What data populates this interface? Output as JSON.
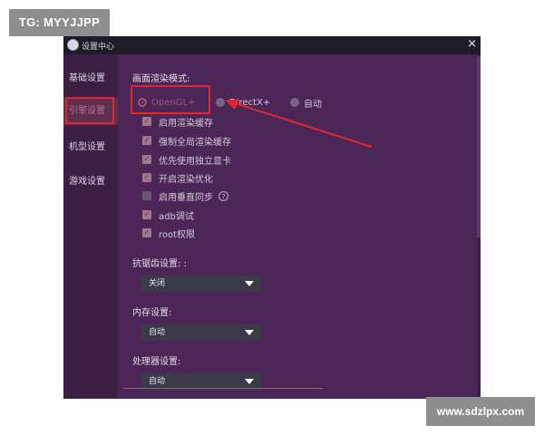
{
  "overlays": {
    "tg_label": "TG: MYYJJPP",
    "url_label": "www.sdzlpx.com"
  },
  "window": {
    "title": "设置中心",
    "close_glyph": "×"
  },
  "sidebar": {
    "items": [
      {
        "label": "基础设置"
      },
      {
        "label": "引擎设置",
        "active": true
      },
      {
        "label": "机型设置"
      },
      {
        "label": "游戏设置"
      }
    ]
  },
  "render_mode": {
    "label": "画面渲染模式:",
    "options": [
      {
        "label": "OpenGL+",
        "selected": true
      },
      {
        "label": "DirectX+",
        "selected": false
      },
      {
        "label": "自动",
        "selected": false
      }
    ]
  },
  "checkboxes": [
    {
      "label": "启用渲染缓存",
      "checked": true
    },
    {
      "label": "强制全局渲染缓存",
      "checked": true
    },
    {
      "label": "优先使用独立显卡",
      "checked": true
    },
    {
      "label": "开启渲染优化",
      "checked": true
    },
    {
      "label": "启用垂直同步",
      "checked": false,
      "help": "?"
    },
    {
      "label": "adb调试",
      "checked": true
    },
    {
      "label": "root权限",
      "checked": true
    }
  ],
  "antialias": {
    "label": "抗锯齿设置: :",
    "value": "关闭"
  },
  "memory": {
    "label": "内存设置:",
    "value": "自动"
  },
  "processor": {
    "label": "处理器设置:",
    "value": "自动"
  },
  "colors": {
    "window_bg": "#4b2656",
    "sidebar_bg": "#3d1f46",
    "highlight_red": "#e0262e",
    "accent": "#a45a78"
  }
}
